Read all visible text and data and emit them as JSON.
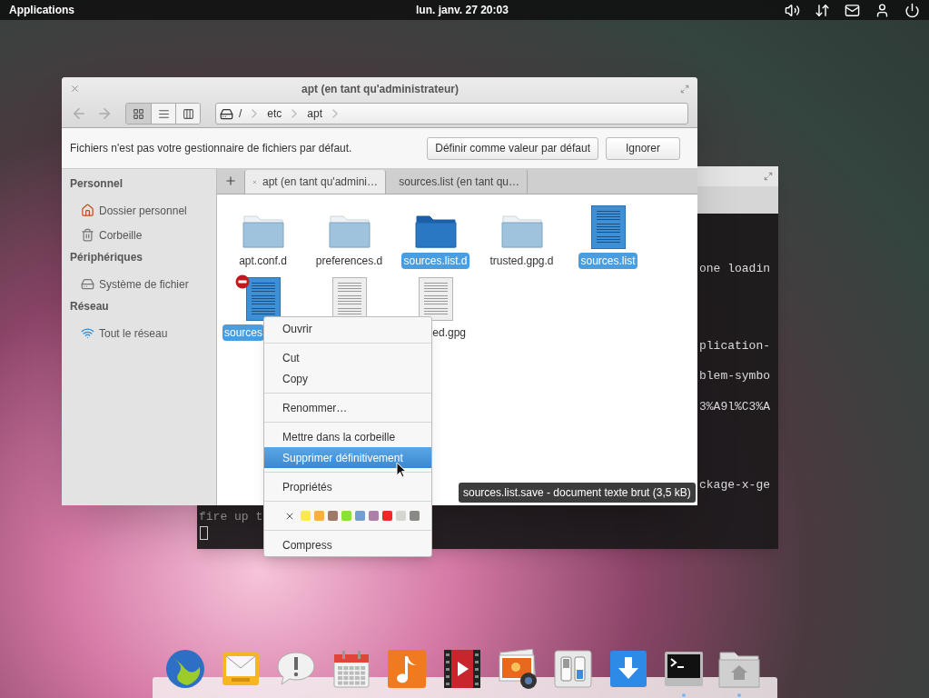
{
  "top_panel": {
    "menu": "Applications",
    "clock": "lun. janv. 27 20:03"
  },
  "terminal": {
    "lines": [
      "one loadin",
      "plication-",
      "blem-symbo",
      "3%A9l%C3%A",
      "ckage-x-ge"
    ],
    "prompt_line": "fire up t"
  },
  "file_manager": {
    "title": "apt (en tant qu'administrateur)",
    "view_modes": [
      {
        "kind": "icons",
        "selected": true
      },
      {
        "kind": "list",
        "selected": false
      },
      {
        "kind": "columns",
        "selected": false
      }
    ],
    "path": [
      "/",
      "etc",
      "apt"
    ],
    "infobar": {
      "message": "Fichiers n'est pas votre gestionnaire de fichiers par défaut.",
      "buttons": [
        "Définir comme valeur par défaut",
        "Ignorer"
      ]
    },
    "sidebar": [
      {
        "heading": "Personnel",
        "items": [
          {
            "label": "Dossier personnel",
            "kind": "home"
          },
          {
            "label": "Corbeille",
            "kind": "trash"
          }
        ]
      },
      {
        "heading": "Périphériques",
        "items": [
          {
            "label": "Système de fichier",
            "kind": "drive"
          }
        ]
      },
      {
        "heading": "Réseau",
        "items": [
          {
            "label": "Tout le réseau",
            "kind": "network"
          }
        ]
      }
    ],
    "tabs": [
      {
        "label": "apt (en tant qu'admini…",
        "selected": true
      },
      {
        "label": "sources.list (en tant qu…",
        "selected": false
      }
    ],
    "files": [
      {
        "name": "apt.conf.d",
        "kind": "folder",
        "selected": false,
        "emblem": false,
        "cut_end": false,
        "cut_start": false
      },
      {
        "name": "preferences.d",
        "kind": "folder",
        "selected": false,
        "emblem": false,
        "cut_end": false,
        "cut_start": false
      },
      {
        "name": "sources.list.d",
        "kind": "folder",
        "selected": true,
        "emblem": false,
        "cut_end": false,
        "cut_start": false
      },
      {
        "name": "trusted.gpg.d",
        "kind": "folder",
        "selected": false,
        "emblem": false,
        "cut_end": false,
        "cut_start": false
      },
      {
        "name": "sources.list",
        "kind": "document",
        "selected": true,
        "emblem": false,
        "cut_end": false,
        "cut_start": false
      },
      {
        "name": "sources",
        "kind": "document",
        "selected": true,
        "emblem": true,
        "cut_end": true,
        "cut_start": false
      },
      {
        "kind": "document",
        "selected": false,
        "emblem": false
      },
      {
        "name": "ed.gpg",
        "kind": "document",
        "selected": false,
        "emblem": false,
        "cut_end": false,
        "cut_start": true
      }
    ]
  },
  "context_menu": {
    "items": [
      {
        "kind": "item",
        "label": "Ouvrir",
        "selected": false
      },
      {
        "kind": "separator"
      },
      {
        "kind": "item",
        "label": "Cut",
        "selected": false
      },
      {
        "kind": "item",
        "label": "Copy",
        "selected": false
      },
      {
        "kind": "separator"
      },
      {
        "kind": "item",
        "label": "Renommer…",
        "selected": false
      },
      {
        "kind": "separator"
      },
      {
        "kind": "item",
        "label": "Mettre dans la corbeille",
        "selected": false
      },
      {
        "kind": "item",
        "label": "Supprimer définitivement",
        "selected": true
      },
      {
        "kind": "separator"
      },
      {
        "kind": "item",
        "label": "Propriétés",
        "selected": false
      },
      {
        "kind": "separator"
      },
      {
        "kind": "colors",
        "colors": [
          {
            "color": "#fce94f"
          },
          {
            "color": "#fcaf3e"
          },
          {
            "color": "#a07866"
          },
          {
            "color": "#8ae234"
          },
          {
            "color": "#729fcf"
          },
          {
            "color": "#ad7fa8"
          },
          {
            "color": "#ef2929"
          },
          {
            "color": "#d3d7cf"
          },
          {
            "color": "#888a85"
          }
        ]
      },
      {
        "kind": "separator"
      },
      {
        "kind": "item",
        "label": "Compress",
        "selected": false
      }
    ]
  },
  "tooltip": "sources.list.save - document texte brut (3,5 kB)",
  "dock": [
    {
      "kind": "browser",
      "running": false
    },
    {
      "kind": "mail",
      "running": false
    },
    {
      "kind": "chat",
      "running": false
    },
    {
      "kind": "calendar",
      "running": false
    },
    {
      "kind": "music",
      "running": false
    },
    {
      "kind": "video",
      "running": false
    },
    {
      "kind": "photos",
      "running": false
    },
    {
      "kind": "settings",
      "running": false
    },
    {
      "kind": "downloads",
      "running": false
    },
    {
      "kind": "terminal",
      "running": true
    },
    {
      "kind": "files",
      "running": true
    }
  ]
}
